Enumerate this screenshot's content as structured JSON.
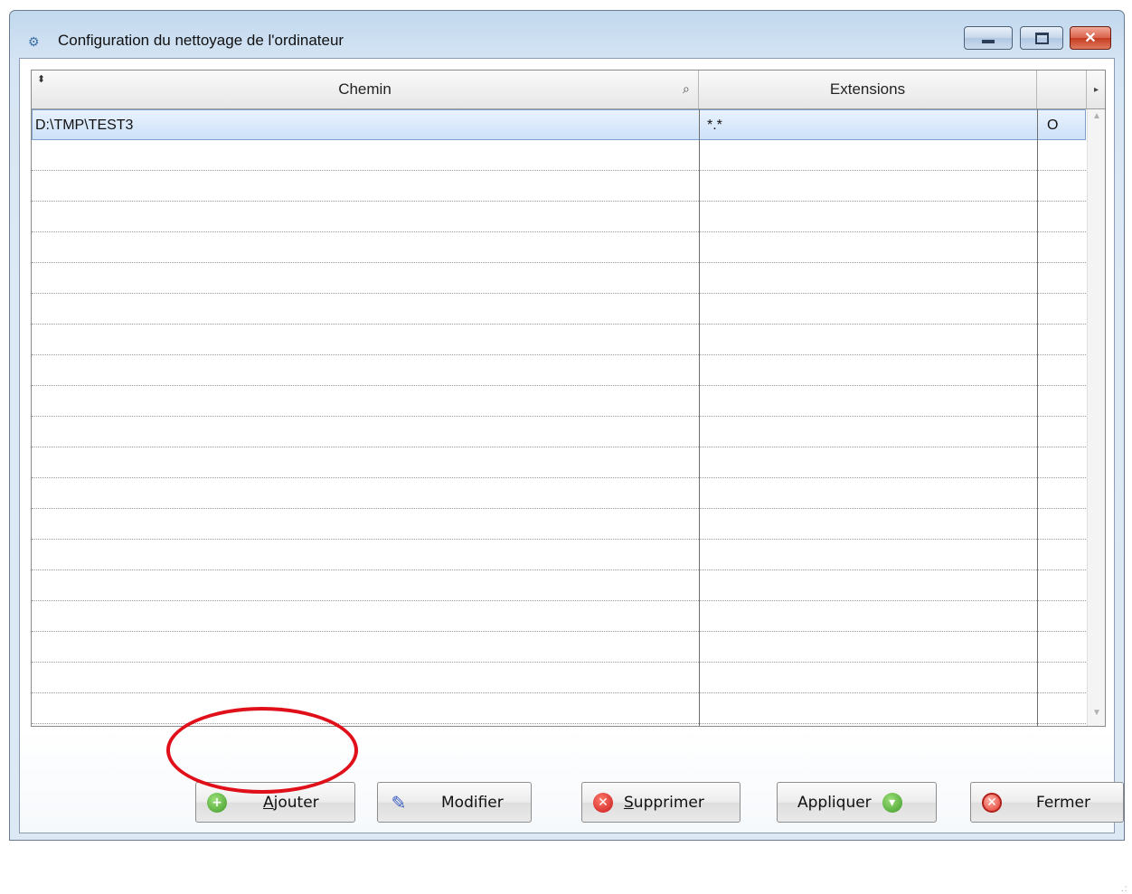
{
  "window": {
    "title": "Configuration du nettoyage de l'ordinateur",
    "controls": {
      "minimize": "minimize",
      "maximize": "maximize",
      "close": "✕"
    }
  },
  "grid": {
    "columns": [
      "Chemin",
      "Extensions",
      ""
    ],
    "rows": [
      {
        "chemin": "D:\\TMP\\TEST3",
        "extensions": "*.*",
        "option": "O"
      }
    ],
    "empty_rows": 19
  },
  "buttons": {
    "ajouter": {
      "pre": "",
      "mnemonic": "A",
      "post": "jouter"
    },
    "modifier": {
      "label": "Modifier"
    },
    "supprimer": {
      "pre": "",
      "mnemonic": "S",
      "post": "upprimer"
    },
    "appliquer": {
      "label": "Appliquer"
    },
    "fermer": {
      "label": "Fermer"
    }
  },
  "colors": {
    "highlight": "#e0101a",
    "selection": "#cde1f8"
  }
}
